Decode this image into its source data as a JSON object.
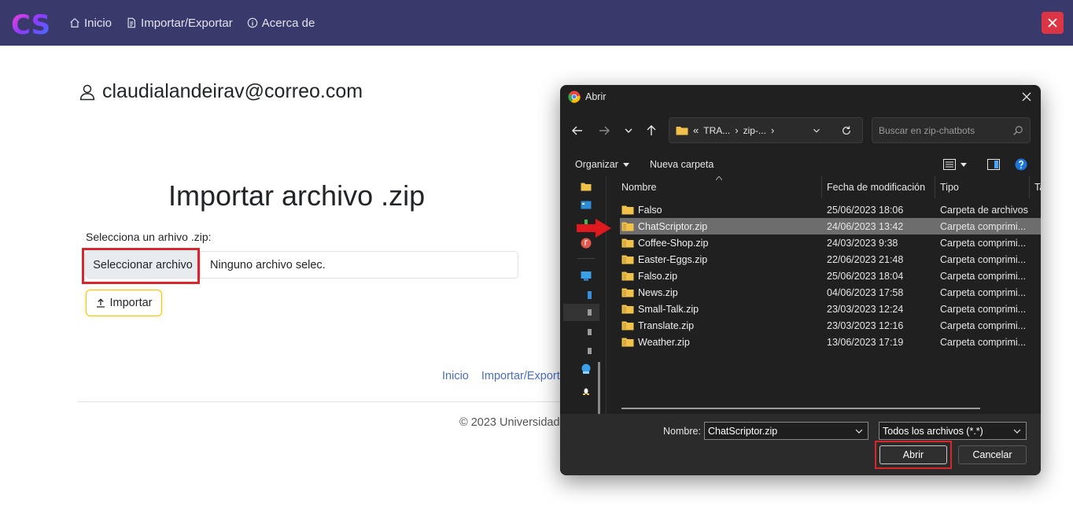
{
  "navbar": {
    "logo_text": "CS",
    "links": [
      {
        "label": "Inicio",
        "icon": "home-icon"
      },
      {
        "label": "Importar/Exportar",
        "icon": "file-icon"
      },
      {
        "label": "Acerca de",
        "icon": "info-icon"
      }
    ],
    "close_icon": "close-icon"
  },
  "user": {
    "email": "claudialandeirav@correo.com"
  },
  "main": {
    "title": "Importar archivo .zip",
    "file_label": "Selecciona un arhivo .zip:",
    "file_button": "Seleccionar archivo",
    "file_status": "Ninguno archivo selec.",
    "import_button": "Importar"
  },
  "footer": {
    "links": [
      "Inicio",
      "Importar/Export"
    ],
    "copyright": "© 2023 Universidad"
  },
  "dialog": {
    "title": "Abrir",
    "address": {
      "prefix": "«",
      "crumbs": [
        "TRA...",
        "zip-..."
      ]
    },
    "search_placeholder": "Buscar en zip-chatbots",
    "toolbar": {
      "organize": "Organizar",
      "new_folder": "Nueva carpeta"
    },
    "columns": [
      "Nombre",
      "Fecha de modificación",
      "Tipo",
      "Ta"
    ],
    "files": [
      {
        "name": "Falso",
        "date": "25/06/2023 18:06",
        "type": "Carpeta de archivos",
        "kind": "folder",
        "selected": false
      },
      {
        "name": "ChatScriptor.zip",
        "date": "24/06/2023 13:42",
        "type": "Carpeta comprimi...",
        "kind": "zip",
        "selected": true
      },
      {
        "name": "Coffee-Shop.zip",
        "date": "24/03/2023 9:38",
        "type": "Carpeta comprimi...",
        "kind": "zip",
        "selected": false
      },
      {
        "name": "Easter-Eggs.zip",
        "date": "22/06/2023 21:48",
        "type": "Carpeta comprimi...",
        "kind": "zip",
        "selected": false
      },
      {
        "name": "Falso.zip",
        "date": "25/06/2023 18:04",
        "type": "Carpeta comprimi...",
        "kind": "zip",
        "selected": false
      },
      {
        "name": "News.zip",
        "date": "04/06/2023 17:58",
        "type": "Carpeta comprimi...",
        "kind": "zip",
        "selected": false
      },
      {
        "name": "Small-Talk.zip",
        "date": "23/03/2023 12:24",
        "type": "Carpeta comprimi...",
        "kind": "zip",
        "selected": false
      },
      {
        "name": "Translate.zip",
        "date": "23/03/2023 12:16",
        "type": "Carpeta comprimi...",
        "kind": "zip",
        "selected": false
      },
      {
        "name": "Weather.zip",
        "date": "13/06/2023 17:19",
        "type": "Carpeta comprimi...",
        "kind": "zip",
        "selected": false
      }
    ],
    "name_label": "Nombre:",
    "name_value": "ChatScriptor.zip",
    "type_filter": "Todos los archivos (*.*)",
    "open_button": "Abrir",
    "cancel_button": "Cancelar"
  },
  "colors": {
    "navbar": "#39396b",
    "highlight": "#d8262c",
    "import_border": "#ffc107",
    "link": "#4a6fc1",
    "dialog_bg": "#202020",
    "selected_row": "#6d6d6d"
  }
}
